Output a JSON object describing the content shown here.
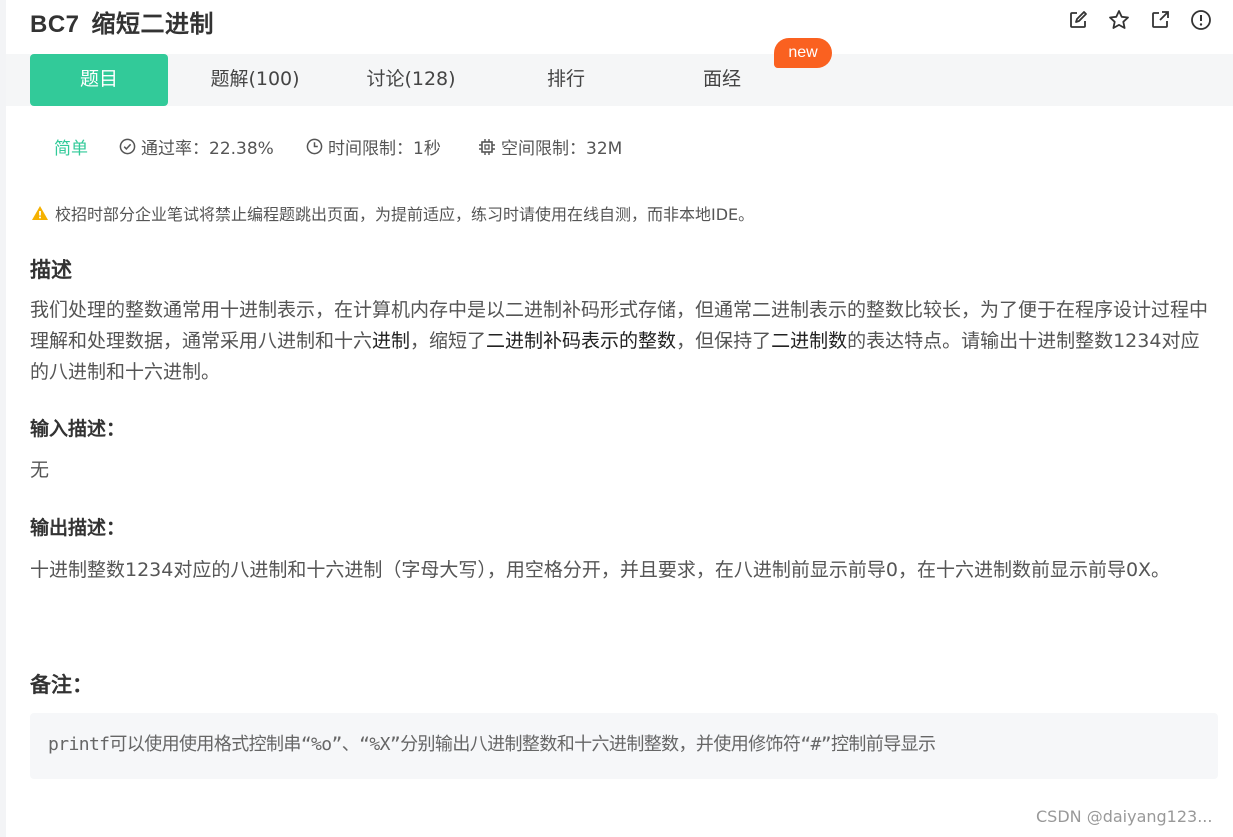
{
  "problem": {
    "id": "BC7",
    "title": "缩短二进制"
  },
  "toolbar_icons": [
    "edit-icon",
    "star-icon",
    "external-link-icon",
    "report-icon"
  ],
  "tabs": [
    {
      "label": "题目",
      "active": true
    },
    {
      "label": "题解(100)",
      "active": false
    },
    {
      "label": "讨论(128)",
      "active": false
    },
    {
      "label": "排行",
      "active": false
    },
    {
      "label": "面经",
      "active": false
    }
  ],
  "new_badge": "new",
  "meta": {
    "difficulty": "简单",
    "pass_rate": "通过率：22.38%",
    "time_limit": "时间限制：1秒",
    "memory_limit": "空间限制：32M"
  },
  "warning": "校招时部分企业笔试将禁止编程题跳出页面，为提前适应，练习时请使用在线自测，而非本地IDE。",
  "description": {
    "heading": "描述",
    "seg1": "我们处理的整数通常用十进制表示，在计算机内存中是以二进制补码形式存储，但通常二进制表示的整数比较长，为了便于在程序设计过程中理解和处理数据，通常采用八进制和十六",
    "seg2": "进制",
    "seg3": "，缩短了",
    "seg4": "二进制补码表示的整数",
    "seg5": "，但保持了",
    "seg6": "二进制数",
    "seg7": "的表达特点。请输出十进制整数1234对应的八进制和十六进制。"
  },
  "input_desc": {
    "heading": "输入描述：",
    "text": "无"
  },
  "output_desc": {
    "heading": "输出描述：",
    "text": "十进制整数1234对应的八进制和十六进制（字母大写），用空格分开，并且要求，在八进制前显示前导0，在十六进制数前显示前导0X。"
  },
  "note": {
    "heading": "备注：",
    "text": "printf可以使用使用格式控制串“%o”、“%X”分别输出八进制整数和十六进制整数，并使用修饰符“#”控制前导显示"
  },
  "watermark": "CSDN @daiyang123...",
  "colors": {
    "accent": "#32ca99",
    "badge": "#fa6120",
    "warning_icon": "#f5b100"
  }
}
